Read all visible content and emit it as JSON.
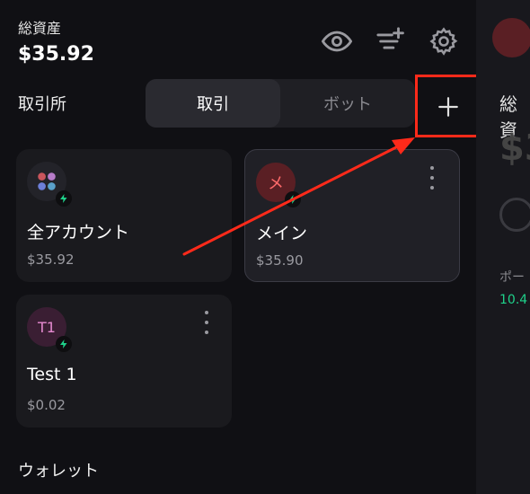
{
  "header": {
    "total_assets_label": "総資産",
    "total_assets_value": "$35.92",
    "icons": [
      "eye-icon",
      "filter-add-icon",
      "gear-icon"
    ]
  },
  "exchange": {
    "section_title": "取引所",
    "tabs": [
      {
        "label": "取引",
        "active": true
      },
      {
        "label": "ボット",
        "active": false
      }
    ],
    "add_icon": "plus-icon",
    "cards": [
      {
        "name": "全アカウント",
        "amount": "$35.92",
        "avatar_icon": "apps-grid-icon",
        "badge_icon": "lightning-icon"
      },
      {
        "name": "メイン",
        "amount": "$35.90",
        "avatar_text": "メ",
        "badge_icon": "lightning-icon",
        "selected": true
      },
      {
        "name": "Test 1",
        "amount": "$0.02",
        "avatar_text": "T1",
        "badge_icon": "lightning-icon"
      }
    ]
  },
  "wallet": {
    "section_title": "ウォレット"
  },
  "right_panel": {
    "heading": "総資",
    "amount_partial": "$3",
    "label_partial": "ポー",
    "value_partial": "10.4"
  },
  "colors": {
    "background": "#101014",
    "card": "#1a1a1e",
    "accent_red": "#ff2a1a",
    "lightning_green": "#1fd18a"
  }
}
